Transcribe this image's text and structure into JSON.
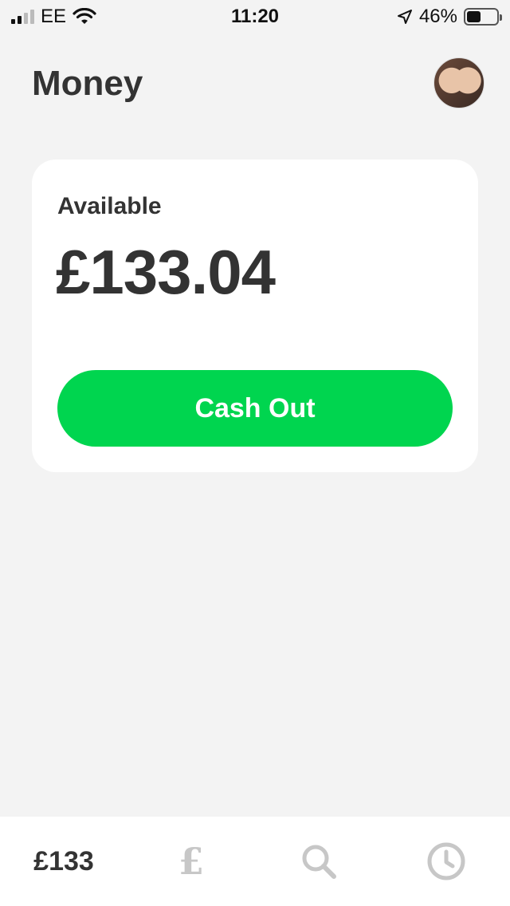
{
  "status_bar": {
    "carrier": "EE",
    "time": "11:20",
    "battery_percent": "46%",
    "battery_level": 0.46
  },
  "header": {
    "title": "Money"
  },
  "balance_card": {
    "label": "Available",
    "amount": "£133.04",
    "cash_out_label": "Cash Out"
  },
  "tabbar": {
    "balance_label": "£133",
    "pound_glyph": "£",
    "icons": [
      "pound-icon",
      "search-icon",
      "clock-icon"
    ]
  },
  "colors": {
    "accent": "#00d54f",
    "background": "#f3f3f3",
    "inactive_icon": "#c7c7c7"
  }
}
